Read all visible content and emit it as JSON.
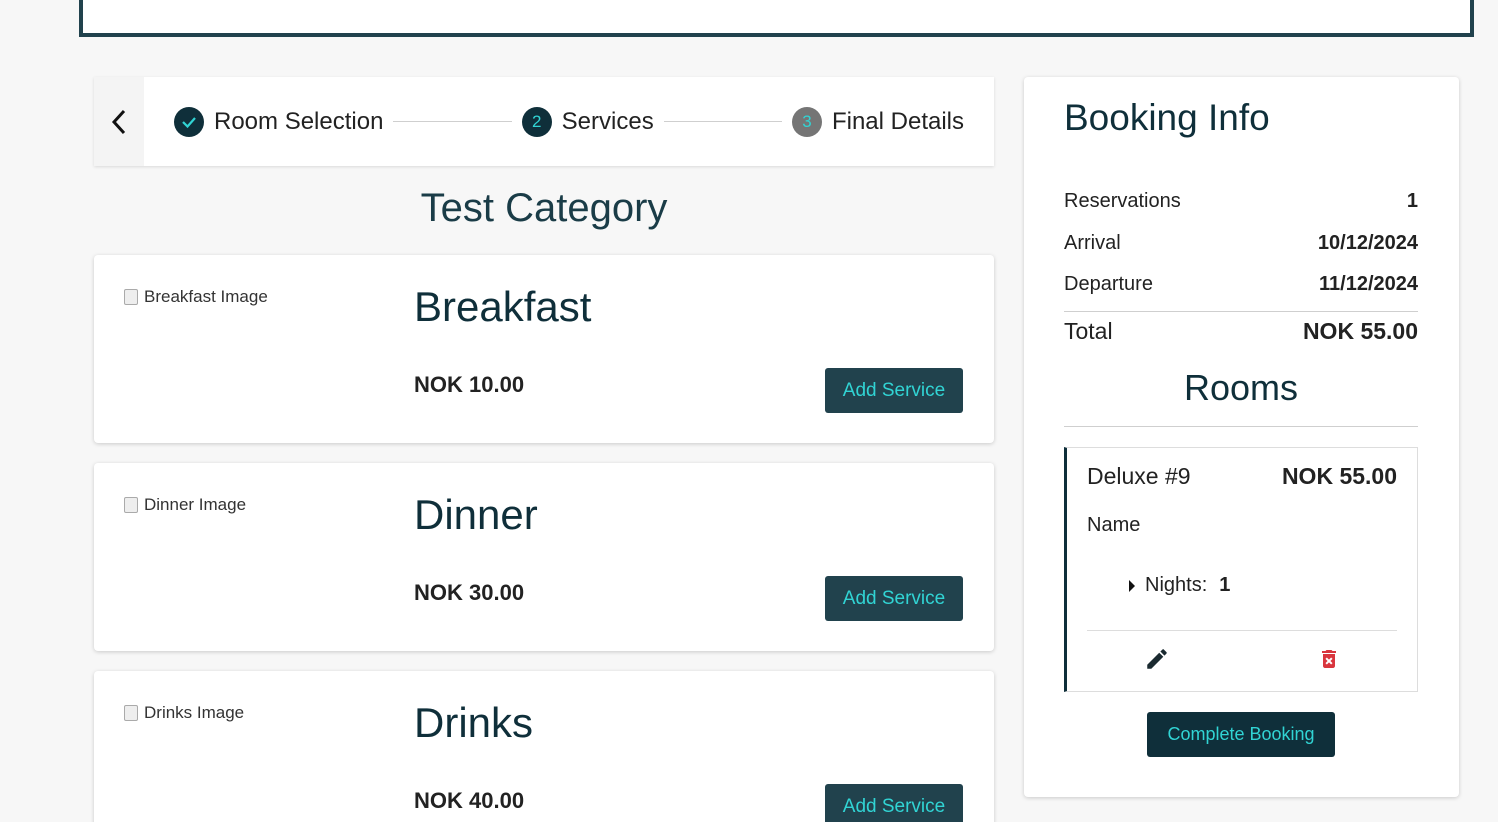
{
  "stepper": {
    "steps": [
      {
        "label": "Room Selection",
        "state": "done"
      },
      {
        "label": "Services",
        "number": "2",
        "state": "active"
      },
      {
        "label": "Final Details",
        "number": "3",
        "state": "pending"
      }
    ]
  },
  "category": {
    "title": "Test Category"
  },
  "services": [
    {
      "image_alt": "Breakfast Image",
      "name": "Breakfast",
      "price": "NOK 10.00",
      "button": "Add Service"
    },
    {
      "image_alt": "Dinner Image",
      "name": "Dinner",
      "price": "NOK 30.00",
      "button": "Add Service"
    },
    {
      "image_alt": "Drinks Image",
      "name": "Drinks",
      "price": "NOK 40.00",
      "button": "Add Service"
    }
  ],
  "booking": {
    "title": "Booking Info",
    "reservations_label": "Reservations",
    "reservations_value": "1",
    "arrival_label": "Arrival",
    "arrival_value": "10/12/2024",
    "departure_label": "Departure",
    "departure_value": "11/12/2024",
    "total_label": "Total",
    "total_value": "NOK 55.00",
    "rooms_title": "Rooms",
    "room": {
      "name": "Deluxe #9",
      "price": "NOK 55.00",
      "guest_label": "Name",
      "nights_label": "Nights:",
      "nights_value": "1"
    },
    "complete_button": "Complete Booking"
  },
  "colors": {
    "primary": "#0f2f3a",
    "accent": "#31d4d4",
    "button": "#21424d",
    "danger": "#d9363e"
  },
  "icons": [
    "chevron-left-icon",
    "check-icon",
    "caret-right-icon",
    "pencil-icon",
    "trash-icon"
  ]
}
